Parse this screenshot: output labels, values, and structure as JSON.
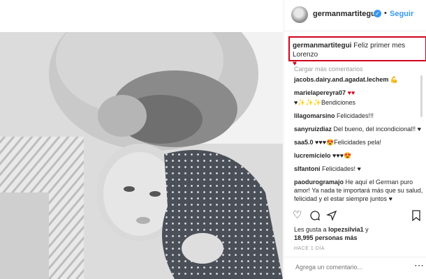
{
  "post": {
    "username": "germanmartitegui",
    "follow_label": "Seguir",
    "caption_user": "germanmartitegui",
    "caption_text": "Feliz primer mes Lorenzo",
    "caption_emoji": "♥",
    "load_more": "Cargar más comentarios",
    "comments": [
      {
        "user": "jacobs.dairy.and.agadat.lechem",
        "text": "💪"
      },
      {
        "user": "marielapereyra07",
        "text": "♥♥"
      },
      {
        "user": "",
        "text": "♥✨✨✨Bendiciones"
      },
      {
        "user": "lilagomarsino",
        "text": "Felicidades!!!"
      },
      {
        "user": "sanyruizdiaz",
        "text": "Del bueno, del incondicional!! ♥"
      },
      {
        "user": "saa5.0",
        "text": "♥♥♥😍Felicidades pela!"
      },
      {
        "user": "lucremicielo",
        "text": "♥♥♥😍"
      },
      {
        "user": "slfantoni",
        "text": "Felicidades! ♥"
      },
      {
        "user": "paodurogramajo",
        "text": "He aquí el German puro amor! Ya nada te importará más que su salud, felicidad y el estar siempre juntos ♥"
      }
    ],
    "likes_prefix": "Les gusta a",
    "likes_user": "lopezsilvia1",
    "likes_suffix": "y",
    "likes_count": "18,995 personas más",
    "age": "HACE 1 DÍA",
    "comment_placeholder": "Agrega un comentario...",
    "more_icon": "⋯",
    "icons": {
      "like": "heart-outline-icon",
      "comment": "comment-bubble-icon",
      "share": "share-icon",
      "save": "bookmark-icon"
    },
    "colors": {
      "link": "#3897f0",
      "highlight_box": "#d0021b"
    }
  }
}
